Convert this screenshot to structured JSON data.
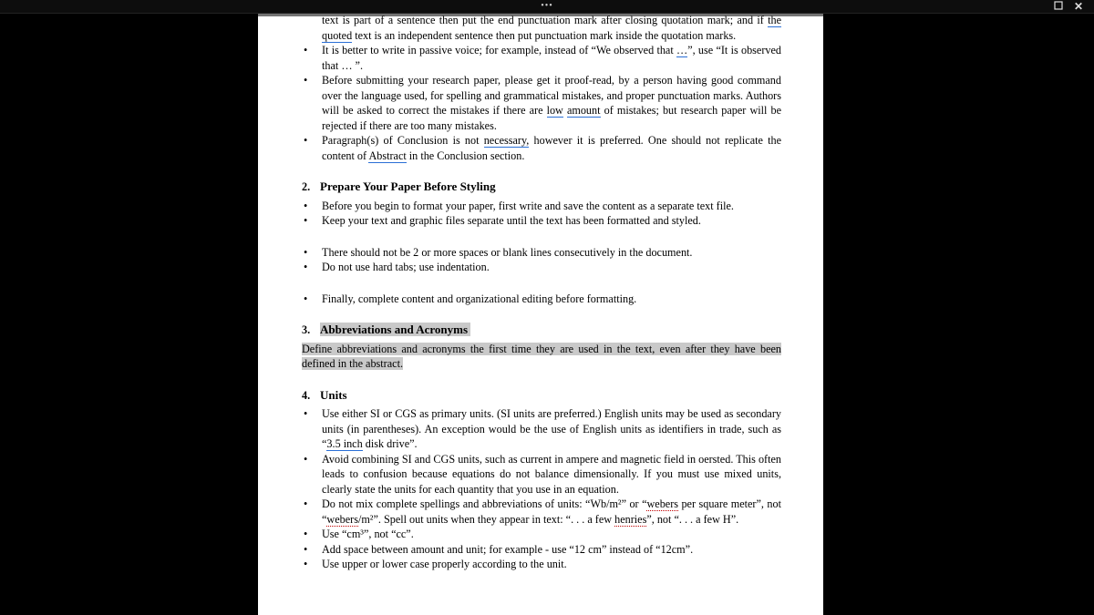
{
  "topbar": {
    "dots": "•••"
  },
  "s1": {
    "b0a": "text is part of a sentence then put the end punctuation mark after closing quotation mark; and if ",
    "b0b": "the quoted",
    "b0c": " text is an independent sentence then put punctuation mark inside the quotation marks.",
    "b1a": "It is better to write in passive voice; for example, instead of “We observed that ",
    "b1u": "…",
    "b1b": "”, use “It is observed that … ”.",
    "b2a": "Before submitting your research paper, please get it proof-read, by a person having good command over the language used, for spelling and grammatical mistakes, and proper punctuation marks. Authors will be asked to correct the mistakes if there are ",
    "b2low": "low",
    "b2sp": " ",
    "b2amt": "amount",
    "b2b": " of mistakes; but research paper will be rejected if there are too many mistakes.",
    "b3a": "Paragraph(s) of Conclusion is not ",
    "b3nec": "necessary,",
    "b3b": " however it is preferred. One should not replicate the content of ",
    "b3abs": "Abstract",
    "b3c": " in the Conclusion section."
  },
  "s2": {
    "num": "2.",
    "title": "Prepare Your Paper Before Styling",
    "i1": "Before you begin to format your paper, first write and save the content as a separate text file.",
    "i2": "Keep your text and graphic files separate until the text has been formatted and styled.",
    "i3": "There should not be 2 or more spaces or blank lines consecutively in the document.",
    "i4": "Do not use hard tabs; use indentation.",
    "i5": "Finally, complete content and organizational editing before formatting."
  },
  "s3": {
    "num": "3.",
    "title": "Abbreviations and Acronyms",
    "para": "Define abbreviations and acronyms the first time they are used in the text, even after they have been defined in the abstract."
  },
  "s4": {
    "num": "4.",
    "title": "Units",
    "i1a": "Use either SI or CGS as primary units. (SI units are preferred.) English units may be used as secondary units (in parentheses). An exception would be the use of English units as identifiers in trade, such as “",
    "i1u": "3.5 inch",
    "i1b": " disk drive”.",
    "i2": "Avoid combining SI and CGS units, such as current in ampere and magnetic field in oersted. This often leads to confusion because equations do not balance dimensionally. If you must use mixed units, clearly state the units for each quantity that you use in an equation.",
    "i3a": "Do not mix complete spellings and abbreviations of units: “Wb/m²” or “",
    "i3w1": "webers",
    "i3b": " per square meter”, not “",
    "i3w2": "webers",
    "i3c": "/m²”.  Spell out units when they appear in text: “. . . a few ",
    "i3h": "henries",
    "i3d": "”, not “. . . a few H”.",
    "i4": "Use “cm³”, not “cc”.",
    "i5": "Add space between amount and unit; for example - use “12 cm” instead of “12cm”.",
    "i6": "Use upper or lower case properly according to the unit."
  }
}
